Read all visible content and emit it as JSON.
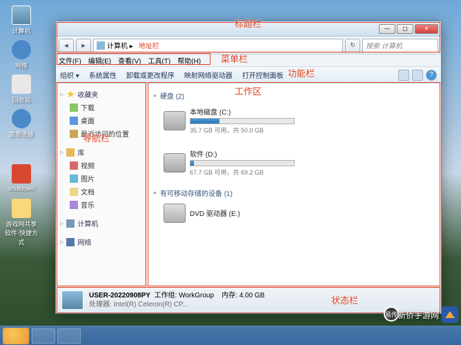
{
  "desktop": {
    "icons": [
      "计算机",
      "网络",
      "回收站",
      "宽带连接",
      "shutdown",
      "游戏网共享软件·快捷方式"
    ]
  },
  "window": {
    "nav": {
      "back": "◄",
      "fwd": "►",
      "crumb": "计算机 ▸",
      "address_label": "地址栏",
      "search_placeholder": "搜索 计算机"
    },
    "menus": [
      "文件(F)",
      "编辑(E)",
      "查看(V)",
      "工具(T)",
      "帮助(H)"
    ],
    "toolbar": {
      "org": "组织 ▾",
      "items": [
        "系统属性",
        "卸载或更改程序",
        "映射网络驱动器",
        "打开控制面板"
      ]
    },
    "sidebar": {
      "favorites": {
        "head": "收藏夹",
        "items": [
          "下载",
          "桌面",
          "最近访问的位置"
        ]
      },
      "libraries": {
        "head": "库",
        "items": [
          "视频",
          "图片",
          "文档",
          "音乐"
        ]
      },
      "computer": {
        "head": "计算机"
      },
      "network": {
        "head": "网络"
      }
    },
    "content": {
      "hdd_head": "硬盘 (2)",
      "removable_head": "有可移动存储的设备 (1)",
      "drives": [
        {
          "name": "本地磁盘 (C:)",
          "free": "35.7 GB 可用，共 50.0 GB",
          "pct": 28
        },
        {
          "name": "软件 (D:)",
          "free": "67.7 GB 可用，共 69.2 GB",
          "pct": 3
        }
      ],
      "dvd": {
        "name": "DVD 驱动器 (E:)"
      }
    },
    "status": {
      "name": "USER-20220908PY",
      "workgroup_label": "工作组:",
      "workgroup": "WorkGroup",
      "mem_label": "内存:",
      "mem": "4.00 GB",
      "cpu_label": "处理器:",
      "cpu": "Intel(R) Celeron(R) CP..."
    }
  },
  "annotations": {
    "title": "标题栏",
    "menu": "菜单栏",
    "tool": "功能栏",
    "nav": "导航栏",
    "work": "工作区",
    "status": "状态栏"
  },
  "watermark": {
    "site": "新侨手游网",
    "wx": "易传"
  }
}
